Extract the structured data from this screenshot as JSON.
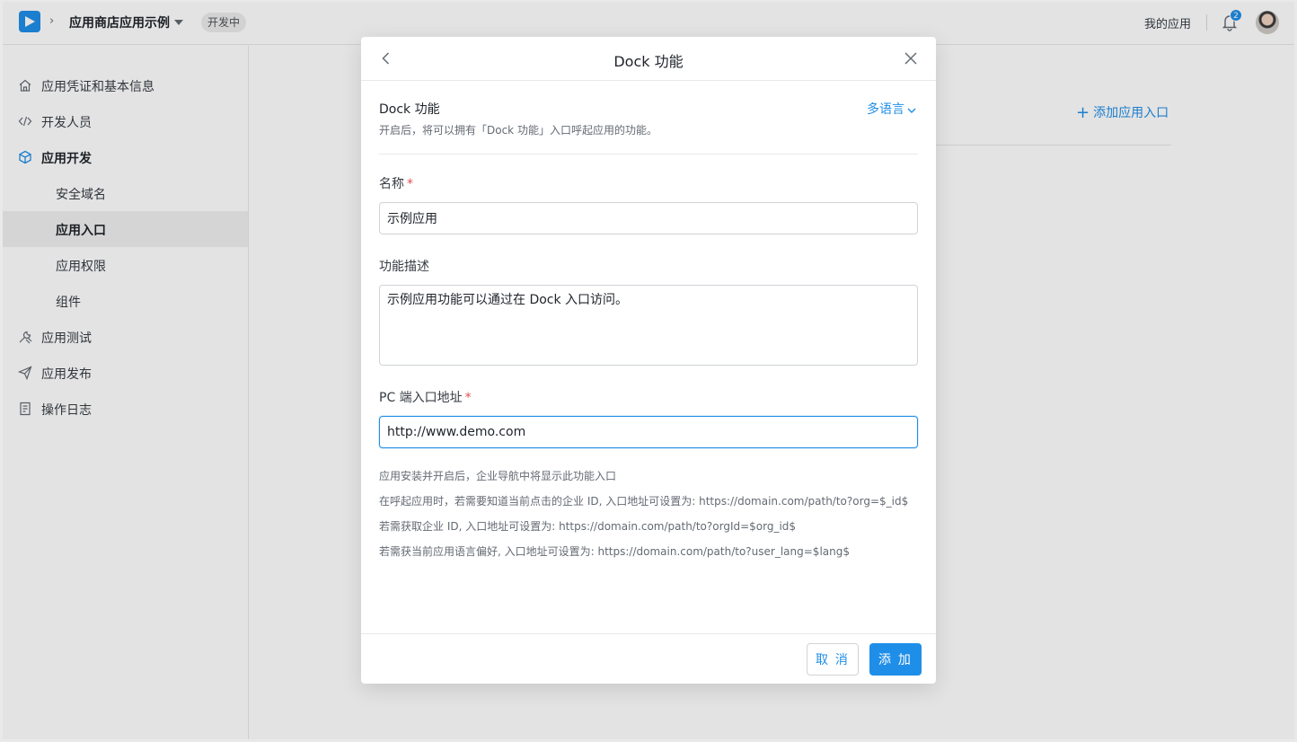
{
  "header": {
    "app_name": "应用商店应用示例",
    "status_tag": "开发中",
    "my_apps": "我的应用",
    "notification_count": "2"
  },
  "sidebar": {
    "items": [
      {
        "label": "应用凭证和基本信息",
        "icon": "home-icon"
      },
      {
        "label": "开发人员",
        "icon": "code-icon"
      },
      {
        "label": "应用开发",
        "icon": "cube-icon"
      },
      {
        "label": "安全域名"
      },
      {
        "label": "应用入口"
      },
      {
        "label": "应用权限"
      },
      {
        "label": "组件"
      },
      {
        "label": "应用测试",
        "icon": "tools-icon"
      },
      {
        "label": "应用发布",
        "icon": "send-icon"
      },
      {
        "label": "操作日志",
        "icon": "log-icon"
      }
    ],
    "active_item": "应用入口"
  },
  "main": {
    "add_entry_label": "添加应用入口"
  },
  "modal": {
    "title": "Dock 功能",
    "section_title": "Dock 功能",
    "section_desc": "开启后，将可以拥有「Dock 功能」入口呼起应用的功能。",
    "lang_button": "多语言",
    "name_label": "名称",
    "name_value": "示例应用",
    "desc_label": "功能描述",
    "desc_value": "示例应用功能可以通过在 Dock 入口访问。",
    "url_label": "PC 端入口地址",
    "url_value": "http://www.demo.com",
    "required_mark": "*",
    "hints": [
      "应用安装并开启后，企业导航中将显示此功能入口",
      "在呼起应用时，若需要知道当前点击的企业 ID, 入口地址可设置为: https://domain.com/path/to?org=$_id$",
      "若需获取企业 ID, 入口地址可设置为: https://domain.com/path/to?orgId=$org_id$",
      "若需获当前应用语言偏好, 入口地址可设置为: https://domain.com/path/to?user_lang=$lang$"
    ],
    "cancel_label": "取 消",
    "ok_label": "添 加"
  },
  "colors": {
    "accent": "#1f8ee8",
    "required": "#e34d4d"
  }
}
